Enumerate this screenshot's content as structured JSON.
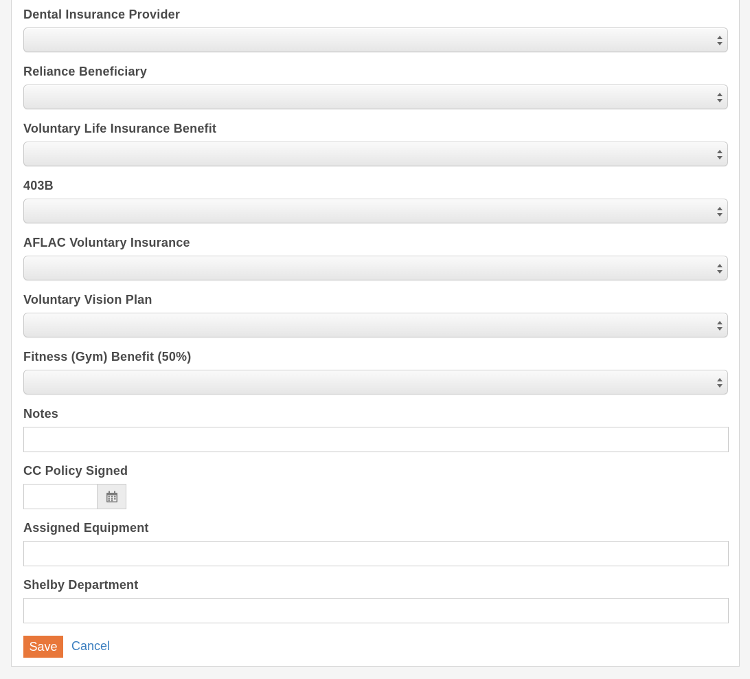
{
  "fields": {
    "dental": {
      "label": "Dental Insurance Provider",
      "value": ""
    },
    "reliance": {
      "label": "Reliance Beneficiary",
      "value": ""
    },
    "voluntary_life": {
      "label": "Voluntary Life Insurance Benefit",
      "value": ""
    },
    "b403": {
      "label": "403B",
      "value": ""
    },
    "aflac": {
      "label": "AFLAC Voluntary Insurance",
      "value": ""
    },
    "vision": {
      "label": "Voluntary Vision Plan",
      "value": ""
    },
    "fitness": {
      "label": "Fitness (Gym) Benefit (50%)",
      "value": ""
    },
    "notes": {
      "label": "Notes",
      "value": ""
    },
    "cc_policy": {
      "label": "CC Policy Signed",
      "value": ""
    },
    "equipment": {
      "label": "Assigned Equipment",
      "value": ""
    },
    "department": {
      "label": "Shelby Department",
      "value": ""
    }
  },
  "icons": {
    "select_arrows": "select-arrows-icon",
    "calendar": "calendar-icon"
  },
  "actions": {
    "save_label": "Save",
    "cancel_label": "Cancel"
  },
  "colors": {
    "save_bg": "#e8773a",
    "cancel_link": "#3a7ebf",
    "label_text": "#4a4a4a"
  }
}
